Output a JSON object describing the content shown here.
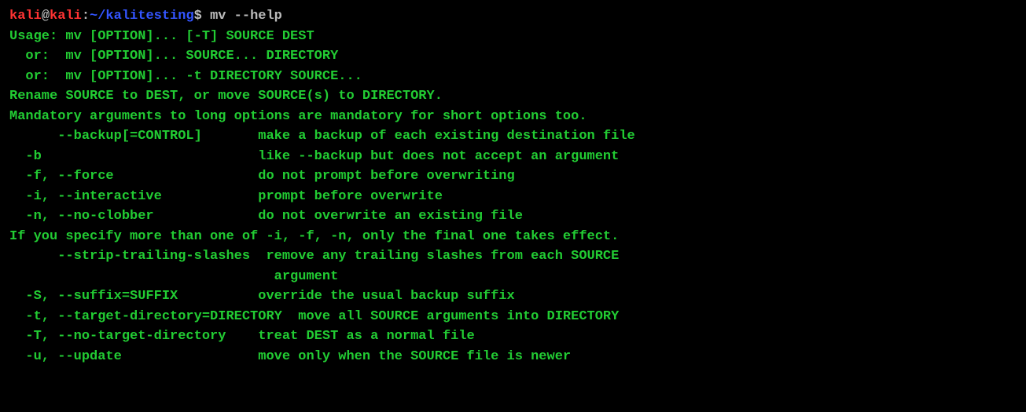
{
  "prompt": {
    "user": "kali",
    "at": "@",
    "host": "kali",
    "colon": ":",
    "path": "~/kalitesting",
    "dollar": "$ ",
    "command": "mv --help"
  },
  "lines": {
    "l0": "Usage: mv [OPTION]... [-T] SOURCE DEST",
    "l1": "  or:  mv [OPTION]... SOURCE... DIRECTORY",
    "l2": "  or:  mv [OPTION]... -t DIRECTORY SOURCE...",
    "l3": "Rename SOURCE to DEST, or move SOURCE(s) to DIRECTORY.",
    "l4": "",
    "l5": "Mandatory arguments to long options are mandatory for short options too.",
    "l6": "      --backup[=CONTROL]       make a backup of each existing destination file",
    "l7": "  -b                           like --backup but does not accept an argument",
    "l8": "  -f, --force                  do not prompt before overwriting",
    "l9": "  -i, --interactive            prompt before overwrite",
    "l10": "  -n, --no-clobber             do not overwrite an existing file",
    "l11": "If you specify more than one of -i, -f, -n, only the final one takes effect.",
    "l12": "      --strip-trailing-slashes  remove any trailing slashes from each SOURCE",
    "l13": "                                 argument",
    "l14": "  -S, --suffix=SUFFIX          override the usual backup suffix",
    "l15": "  -t, --target-directory=DIRECTORY  move all SOURCE arguments into DIRECTORY",
    "l16": "  -T, --no-target-directory    treat DEST as a normal file",
    "l17": "  -u, --update                 move only when the SOURCE file is newer"
  }
}
